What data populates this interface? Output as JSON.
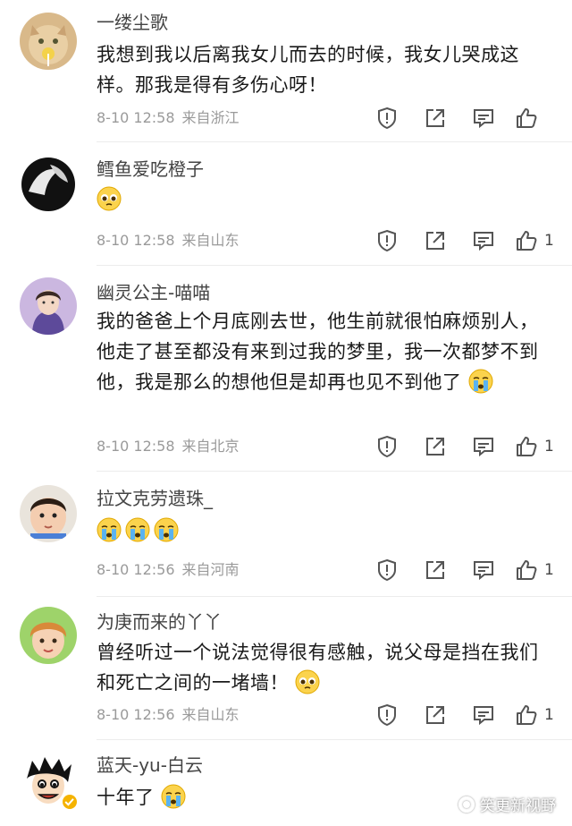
{
  "comments": [
    {
      "username": "一缕尘歌",
      "text": "我想到我以后离我女儿而去的时候，我女儿哭成这样。那我是得有多伤心呀！",
      "emojis": [],
      "date": "8-10 12:58",
      "location": "来自浙江",
      "likes": ""
    },
    {
      "username": "鳕鱼爱吃橙子",
      "text": "",
      "emojis": [
        "pleading-face"
      ],
      "date": "8-10 12:58",
      "location": "来自山东",
      "likes": "1"
    },
    {
      "username": "幽灵公主-喵喵",
      "text": "我的爸爸上个月底刚去世，他生前就很怕麻烦别人，他走了甚至都没有来到过我的梦里，我一次都梦不到他，我是那么的想他但是却再也见不到他了",
      "emojis": [
        "crying-face"
      ],
      "date": "8-10 12:58",
      "location": "来自北京",
      "likes": "1"
    },
    {
      "username": "拉文克劳遗珠_",
      "text": "",
      "emojis": [
        "crying-face",
        "crying-face",
        "crying-face"
      ],
      "date": "8-10 12:56",
      "location": "来自河南",
      "likes": "1"
    },
    {
      "username": "为庚而来的丫丫",
      "text": "曾经听过一个说法觉得很有感触，说父母是挡在我们和死亡之间的一堵墙！",
      "emojis": [
        "pleading-face"
      ],
      "date": "8-10 12:56",
      "location": "来自山东",
      "likes": "1"
    },
    {
      "username": "蓝天-yu-白云",
      "text": "十年了",
      "emojis": [
        "crying-face"
      ],
      "date": "",
      "location": "",
      "likes": ""
    }
  ],
  "watermark": "笑更新视野",
  "icons": {
    "report": "report-icon",
    "share": "share-icon",
    "reply": "reply-icon",
    "like": "thumbs-up-icon"
  },
  "colors": {
    "meta_gray": "#9a9a9a",
    "icon_gray": "#555555",
    "verified_gold": "#f5b300"
  }
}
